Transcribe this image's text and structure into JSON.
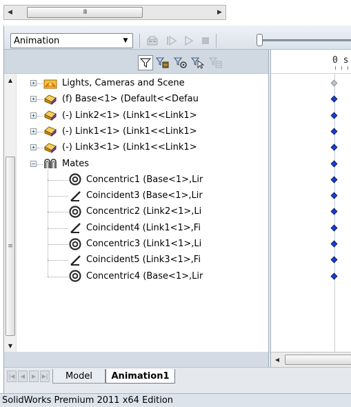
{
  "top_scrollbar": {
    "thumb_grip": "III",
    "left_arrow": "◀",
    "right_arrow": "▶"
  },
  "toolbar": {
    "study_select": {
      "value": "Animation",
      "dropdown_glyph": "▼"
    },
    "buttons": [
      "calculate-icon",
      "play-from-start-icon",
      "play-icon",
      "stop-icon"
    ]
  },
  "filter_toolbar": {
    "buttons": [
      "filter-animated-icon",
      "filter-driving-icon",
      "filter-selected-icon",
      "filter-results-icon",
      "filter-all-icon"
    ]
  },
  "timeline": {
    "start_label": "0 s"
  },
  "tree": {
    "items": [
      {
        "label": "Lights, Cameras and Scene",
        "icon": "lights-cameras-icon",
        "level": 0,
        "expander": "+"
      },
      {
        "label": "(f) Base<1> (Default<<Defau",
        "icon": "part-icon",
        "level": 0,
        "expander": "+"
      },
      {
        "label": "(-) Link2<1> (Link1<<Link1>",
        "icon": "part-icon",
        "level": 0,
        "expander": "+"
      },
      {
        "label": "(-) Link1<1> (Link1<<Link1>",
        "icon": "part-icon",
        "level": 0,
        "expander": "+"
      },
      {
        "label": "(-) Link3<1> (Link1<<Link1>",
        "icon": "part-icon",
        "level": 0,
        "expander": "+"
      },
      {
        "label": "Mates",
        "icon": "mates-icon",
        "level": 0,
        "expander": "−"
      },
      {
        "label": "Concentric1 (Base<1>,Lir",
        "icon": "concentric-mate-icon",
        "level": 1
      },
      {
        "label": "Coincident3 (Base<1>,Lir",
        "icon": "coincident-mate-icon",
        "level": 1
      },
      {
        "label": "Concentric2 (Link2<1>,Li",
        "icon": "concentric-mate-icon",
        "level": 1
      },
      {
        "label": "Coincident4 (Link1<1>,Fi",
        "icon": "coincident-mate-icon",
        "level": 1
      },
      {
        "label": "Concentric3 (Link1<1>,Li",
        "icon": "concentric-mate-icon",
        "level": 1
      },
      {
        "label": "Coincident5 (Link3<1>,Fi",
        "icon": "coincident-mate-icon",
        "level": 1
      },
      {
        "label": "Concentric4 (Base<1>,Lir",
        "icon": "concentric-mate-icon",
        "level": 1
      }
    ]
  },
  "tree_scrollbar": {
    "grip": "≡",
    "up_arrow": "▲",
    "down_arrow": "▼"
  },
  "timeline_scrollbar": {
    "left_arrow": "◀"
  },
  "tabs": {
    "model": "Model",
    "animation": "Animation1",
    "active": "Animation1"
  },
  "status_bar": {
    "text": "SolidWorks Premium 2011 x64 Edition"
  },
  "colors": {
    "key_blue": "#1a3fd0",
    "panel_bg": "#d4dbe4"
  }
}
